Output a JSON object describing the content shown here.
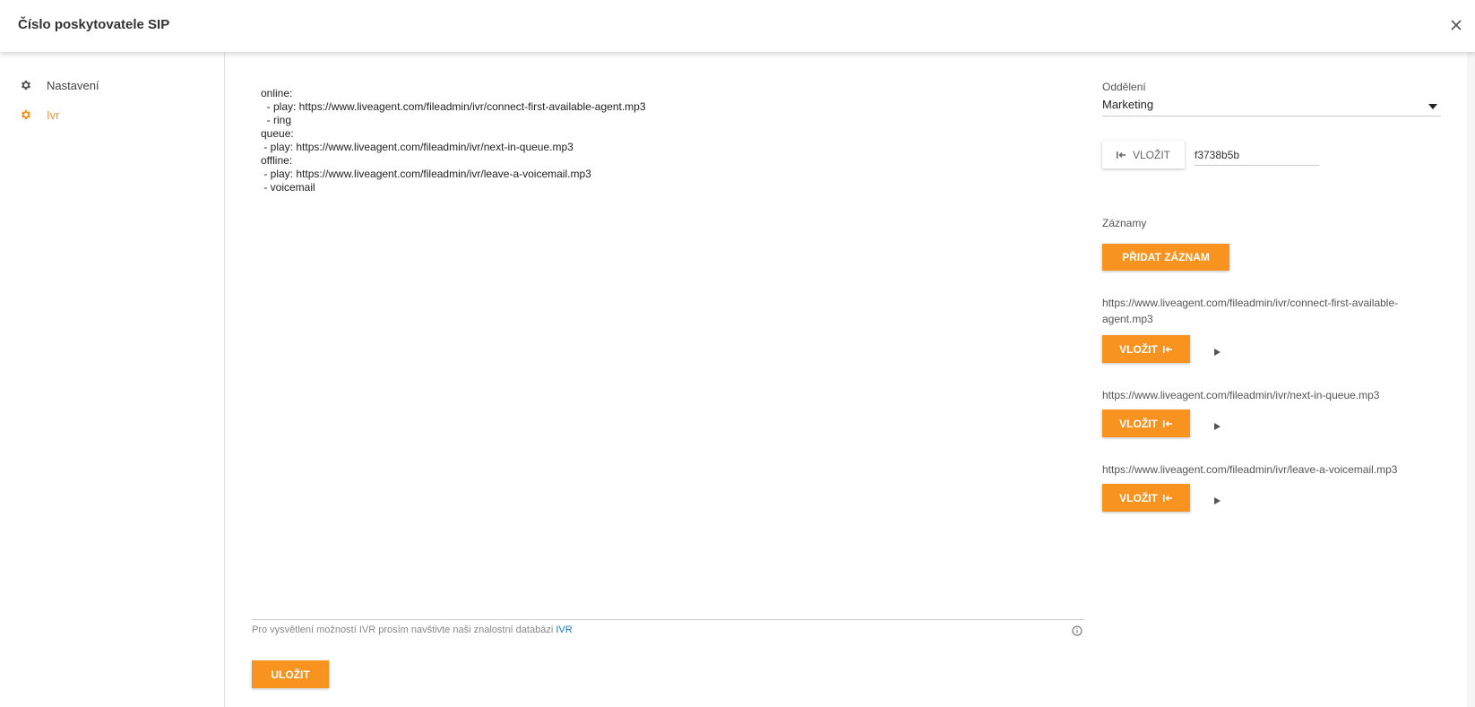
{
  "dialog": {
    "title": "Číslo poskytovatele SIP",
    "close_icon": "close-icon"
  },
  "sidebar": {
    "items": [
      {
        "label": "Nastavení",
        "icon": "gear-icon",
        "active": false
      },
      {
        "label": "Ivr",
        "icon": "gear-icon",
        "active": true
      }
    ]
  },
  "ivr": {
    "script": "online:\n  - play: https://www.liveagent.com/fileadmin/ivr/connect-first-available-agent.mp3\n  - ring\nqueue:\n - play: https://www.liveagent.com/fileadmin/ivr/next-in-queue.mp3\noffline:\n - play: https://www.liveagent.com/fileadmin/ivr/leave-a-voicemail.mp3\n - voicemail",
    "hint_text": "Pro vysvětlení možností IVR prosím navštivte naši znalostní databázi ",
    "hint_link": "IVR",
    "save_label": "ULOŽIT"
  },
  "department": {
    "label": "Oddělení",
    "selected": "Marketing",
    "insert_label": "VLOŽIT",
    "code_value": "f3738b5b"
  },
  "records": {
    "label": "Záznamy",
    "add_label": "PŘIDAT ZÁZNAM",
    "items": [
      {
        "url": "https://www.liveagent.com/fileadmin/ivr/connect-first-available-agent.mp3",
        "insert_label": "VLOŽIT"
      },
      {
        "url": "https://www.liveagent.com/fileadmin/ivr/next-in-queue.mp3",
        "insert_label": "VLOŽIT"
      },
      {
        "url": "https://www.liveagent.com/fileadmin/ivr/leave-a-voicemail.mp3",
        "insert_label": "VLOŽIT"
      }
    ]
  },
  "colors": {
    "accent": "#f7931e",
    "link": "#1a7bc4"
  }
}
